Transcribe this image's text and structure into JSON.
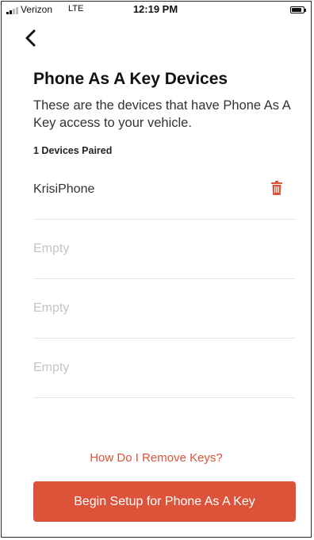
{
  "status_bar": {
    "carrier": "Verizon",
    "network": "LTE",
    "time": "12:19 PM"
  },
  "header": {
    "title": "Phone As A Key Devices",
    "description": "These are the devices that have Phone As A Key access to your vehicle.",
    "paired_count": "1 Devices Paired"
  },
  "devices": [
    {
      "name": "KrisiPhone",
      "empty": false,
      "icon": "trash-icon"
    },
    {
      "name": "Empty",
      "empty": true
    },
    {
      "name": "Empty",
      "empty": true
    },
    {
      "name": "Empty",
      "empty": true
    }
  ],
  "actions": {
    "remove_link": "How Do I Remove Keys?",
    "setup_button": "Begin Setup for Phone As A Key"
  },
  "colors": {
    "accent": "#dd533a",
    "text": "#222222",
    "placeholder": "#c4c4c4"
  }
}
